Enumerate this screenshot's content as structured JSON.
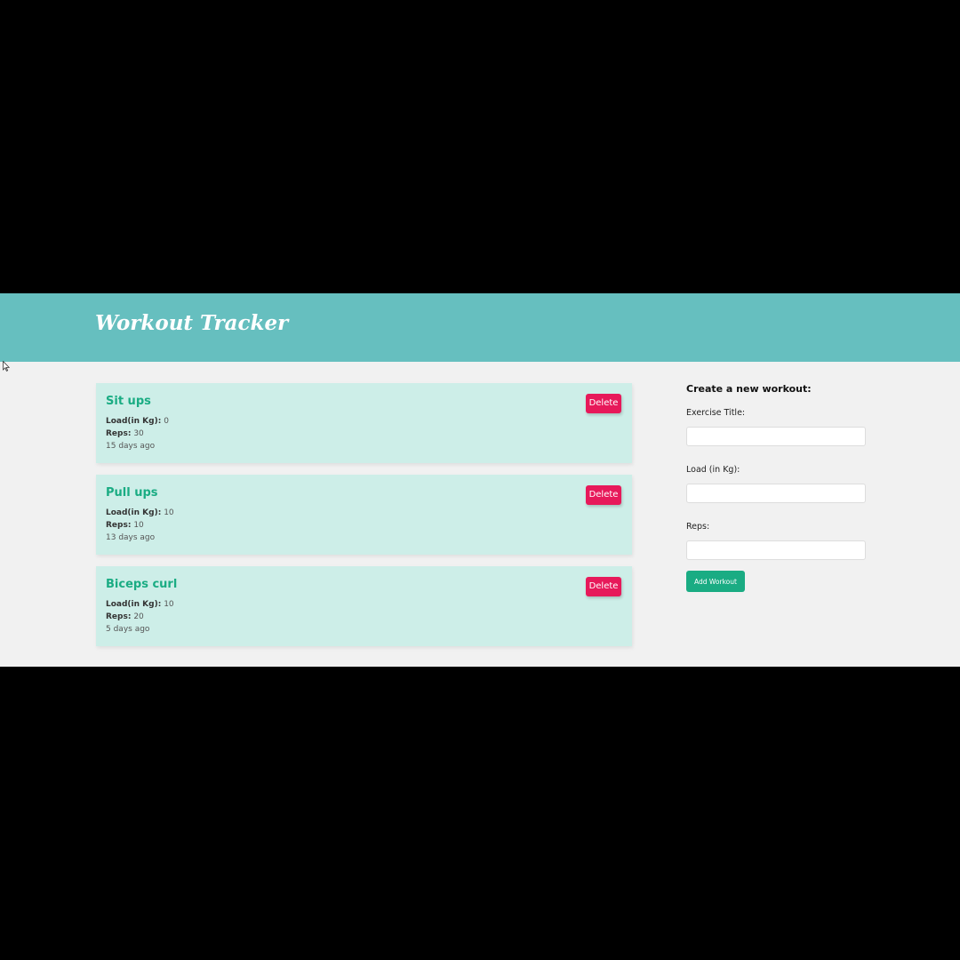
{
  "app": {
    "brand": "Workout Tracker"
  },
  "workouts": [
    {
      "title": "Sit ups",
      "load_label": "Load(in Kg):",
      "load_value": "0",
      "reps_label": "Reps:",
      "reps_value": "30",
      "time_ago": "15 days ago",
      "delete_label": "Delete"
    },
    {
      "title": "Pull ups",
      "load_label": "Load(in Kg):",
      "load_value": "10",
      "reps_label": "Reps:",
      "reps_value": "10",
      "time_ago": "13 days ago",
      "delete_label": "Delete"
    },
    {
      "title": "Biceps curl",
      "load_label": "Load(in Kg):",
      "load_value": "10",
      "reps_label": "Reps:",
      "reps_value": "20",
      "time_ago": "5 days ago",
      "delete_label": "Delete"
    }
  ],
  "form": {
    "heading": "Create a new workout:",
    "title_label": "Exercise Title:",
    "title_value": "",
    "load_label": "Load (in Kg):",
    "load_value": "",
    "reps_label": "Reps:",
    "reps_value": "",
    "submit_label": "Add Workout"
  },
  "colors": {
    "navbar": "#66bfbf",
    "accent": "#1aac83",
    "danger": "#e7195a",
    "card_bg": "#cdeee8",
    "page_bg": "#f1f1f1"
  },
  "icons": {
    "cursor": "mouse-pointer-icon"
  }
}
